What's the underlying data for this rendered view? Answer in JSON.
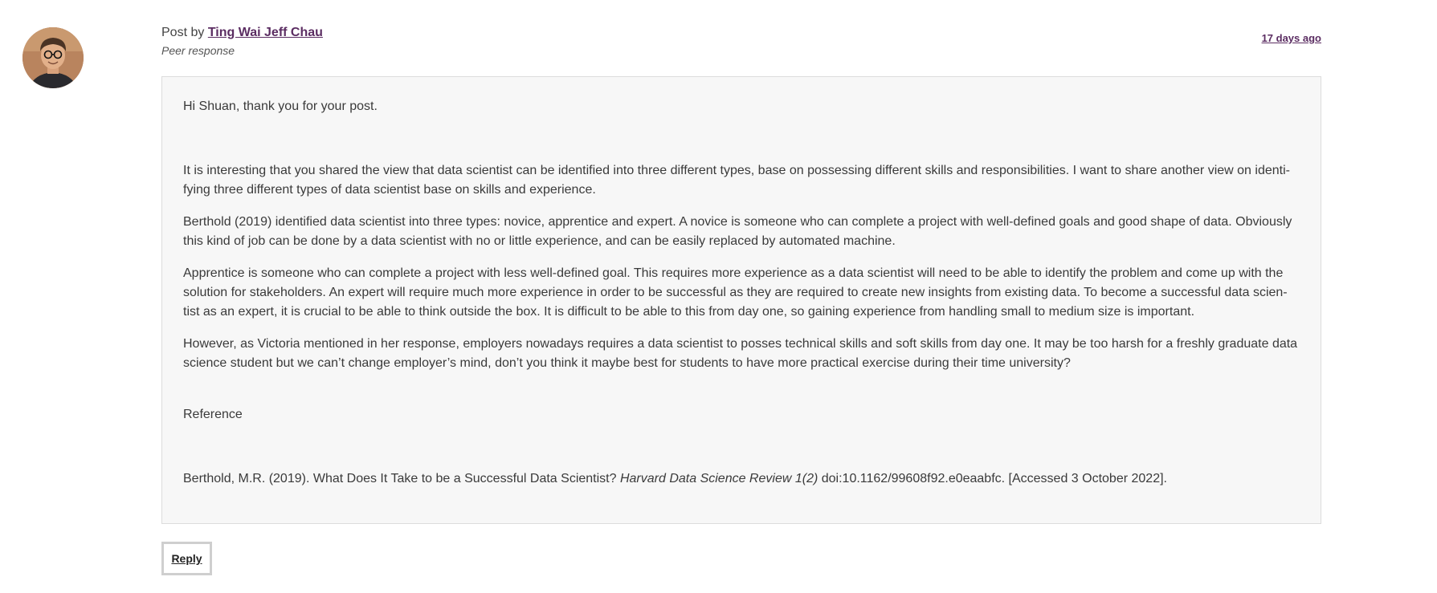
{
  "post": {
    "author_prefix": "Post by",
    "author_name": "Ting Wai Jeff Chau",
    "post_type": "Peer response",
    "timestamp": "17 days ago",
    "body": {
      "greeting": "Hi Shuan, thank you for your post.",
      "paragraphs": [
        "It is interesting that you shared the view that data scientist can be identified into three different types, base on possessing different skills and responsibilities. I want to share another view on identi-fying three different types of data scientist base on skills and experience.",
        "Berthold (2019) identified data scientist into three types: novice, apprentice and expert. A novice is someone who can complete a project with well-defined goals and good shape of data. Obviously this kind of job can be done by a  data scientist with no or little experience, and can be easily replaced by automated machine.",
        "Apprentice is someone who can complete a project with less well-defined goal. This requires more experience as a data scientist will need to be able to identify the problem and come up with the solution for stakeholders. An expert will require much more experience in order to be successful as they are required to create new insights from existing data. To become a successful data scien-tist as an expert, it is crucial to be able to think outside the box. It is difficult to be able to this from day one, so gaining experience from handling small to medium size is important.",
        "However, as Victoria mentioned in her response, employers nowadays requires a data scientist to posses technical skills and soft skills from day one. It may be too harsh for a freshly graduate data science student but we can’t change employer’s mind, don’t you think it maybe best for students to have more practical exercise during their time university?"
      ],
      "reference_heading": "Reference",
      "reference": {
        "before": "Berthold, M.R. (2019). What Does It Take to be a Successful Data Scientist? ",
        "journal": "Harvard Data Science Review 1(2)",
        "after": " doi:10.1162/99608f92.e0eaabfc. [Accessed 3 October 2022]."
      }
    },
    "reply_label": "Reply"
  },
  "colors": {
    "link": "#5b2d62",
    "box_background": "#f7f7f7",
    "box_border": "#dcdcdc"
  },
  "icons": {
    "avatar": "user-avatar-photo"
  }
}
